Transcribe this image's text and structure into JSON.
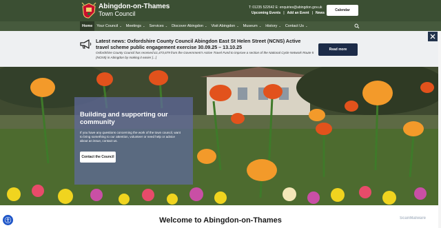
{
  "header": {
    "brand_name": "Abingdon-on-Thames",
    "brand_sub": "Town Council",
    "contact_line": "T: 01235 522642 E: enquiries@abingdon.gov.uk",
    "quicklinks": [
      "Upcoming Events",
      "Add an Event",
      "News"
    ],
    "calendar_label": "Calendar",
    "crest_icon": "town-crest-icon"
  },
  "nav": {
    "items": [
      {
        "label": "Home",
        "active": true,
        "dropdown": false
      },
      {
        "label": "Your Council",
        "dropdown": true
      },
      {
        "label": "Meetings",
        "dropdown": true
      },
      {
        "label": "Services",
        "dropdown": true
      },
      {
        "label": "Discover Abingdon",
        "dropdown": true
      },
      {
        "label": "Visit Abingdon",
        "dropdown": true
      },
      {
        "label": "Museum",
        "dropdown": true
      },
      {
        "label": "History",
        "dropdown": true
      },
      {
        "label": "Contact Us",
        "dropdown": true
      }
    ],
    "search_icon": "search-icon"
  },
  "notice": {
    "title": "Latest news: Oxfordshire County Council Abingdon East St Helen Street (NCNS) Active travel scheme public engagement exercise 30.09.25 – 13.10.25",
    "body": "Oxfordshire County Council has received £1,473,679 from the Government's Active Travel Fund to improve a section of the National Cycle Network Route 5 (NCN5) in Abingdon by making it easier [...]",
    "read_more_label": "Read more",
    "icon": "megaphone-icon",
    "close_icon": "close-icon"
  },
  "hero": {
    "title": "Building and supporting our community",
    "text": "If you have any questions concerning the work of the town council, want to bring something to our attention, volunteer or need help or advice about an issue, contact us.",
    "button_label": "Contact the Council"
  },
  "welcome_title": "Welcome to Abingdon-on-Thames",
  "watermark": "ScanMalware",
  "colors": {
    "header_bg": "#3b4f33",
    "nav_bg": "#465a3d",
    "read_more_bg": "#1c2b48",
    "hero_panel": "#6069a0"
  }
}
